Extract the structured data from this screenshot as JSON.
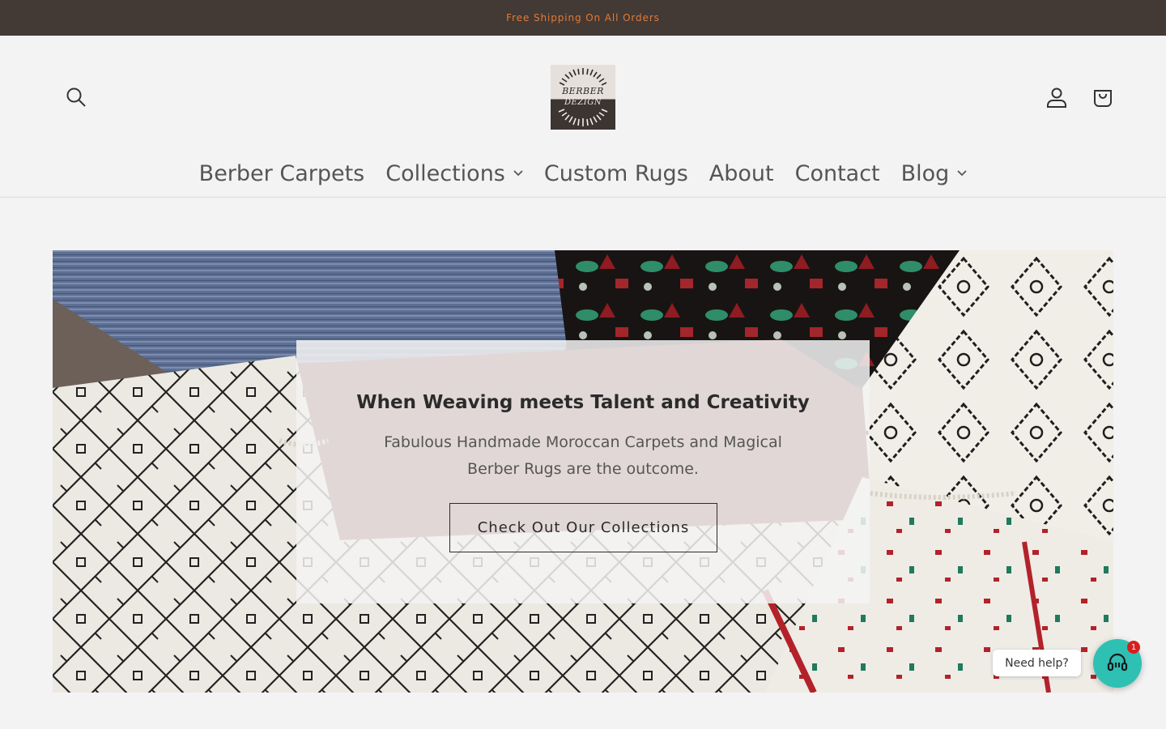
{
  "announcement": {
    "text": "Free Shipping On All Orders"
  },
  "header": {
    "logo": {
      "line1": "BERBER",
      "line2": "DEZIGN"
    },
    "icons": {
      "search": "search-icon",
      "account": "account-icon",
      "cart": "cart-icon"
    }
  },
  "nav": {
    "items": [
      {
        "label": "Berber Carpets",
        "dropdown": false
      },
      {
        "label": "Collections",
        "dropdown": true
      },
      {
        "label": "Custom Rugs",
        "dropdown": false
      },
      {
        "label": "About",
        "dropdown": false
      },
      {
        "label": "Contact",
        "dropdown": false
      },
      {
        "label": "Blog",
        "dropdown": true
      }
    ]
  },
  "hero": {
    "title": "When Weaving meets Talent and Creativity",
    "subtitle": "Fabulous Handmade Moroccan Carpets and Magical Berber Rugs are the outcome.",
    "cta_label": "Check Out Our Collections"
  },
  "chat": {
    "bubble_text": "Need help?",
    "badge_count": "1",
    "icon": "headset-icon"
  },
  "colors": {
    "announcement_bg": "#433935",
    "announcement_text": "#e27b37",
    "page_bg": "#f3f3f3",
    "chat_accent": "#2fc0b4"
  }
}
